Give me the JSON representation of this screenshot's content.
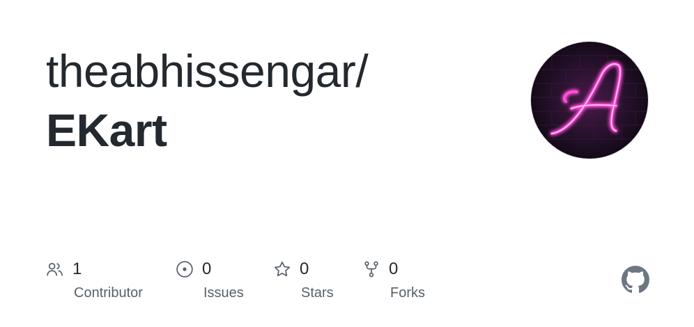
{
  "repo": {
    "owner": "theabhissengar/",
    "name": "EKart"
  },
  "avatar": {
    "letter": "A",
    "glow_color": "#ff3fd1",
    "background_color": "#1d0f22"
  },
  "stats": [
    {
      "icon": "people-icon",
      "count": "1",
      "label": "Contributor"
    },
    {
      "icon": "issue-circle-icon",
      "count": "0",
      "label": "Issues"
    },
    {
      "icon": "star-icon",
      "count": "0",
      "label": "Stars"
    },
    {
      "icon": "fork-icon",
      "count": "0",
      "label": "Forks"
    }
  ],
  "brand": {
    "icon": "github-icon",
    "color": "#6e7781"
  }
}
